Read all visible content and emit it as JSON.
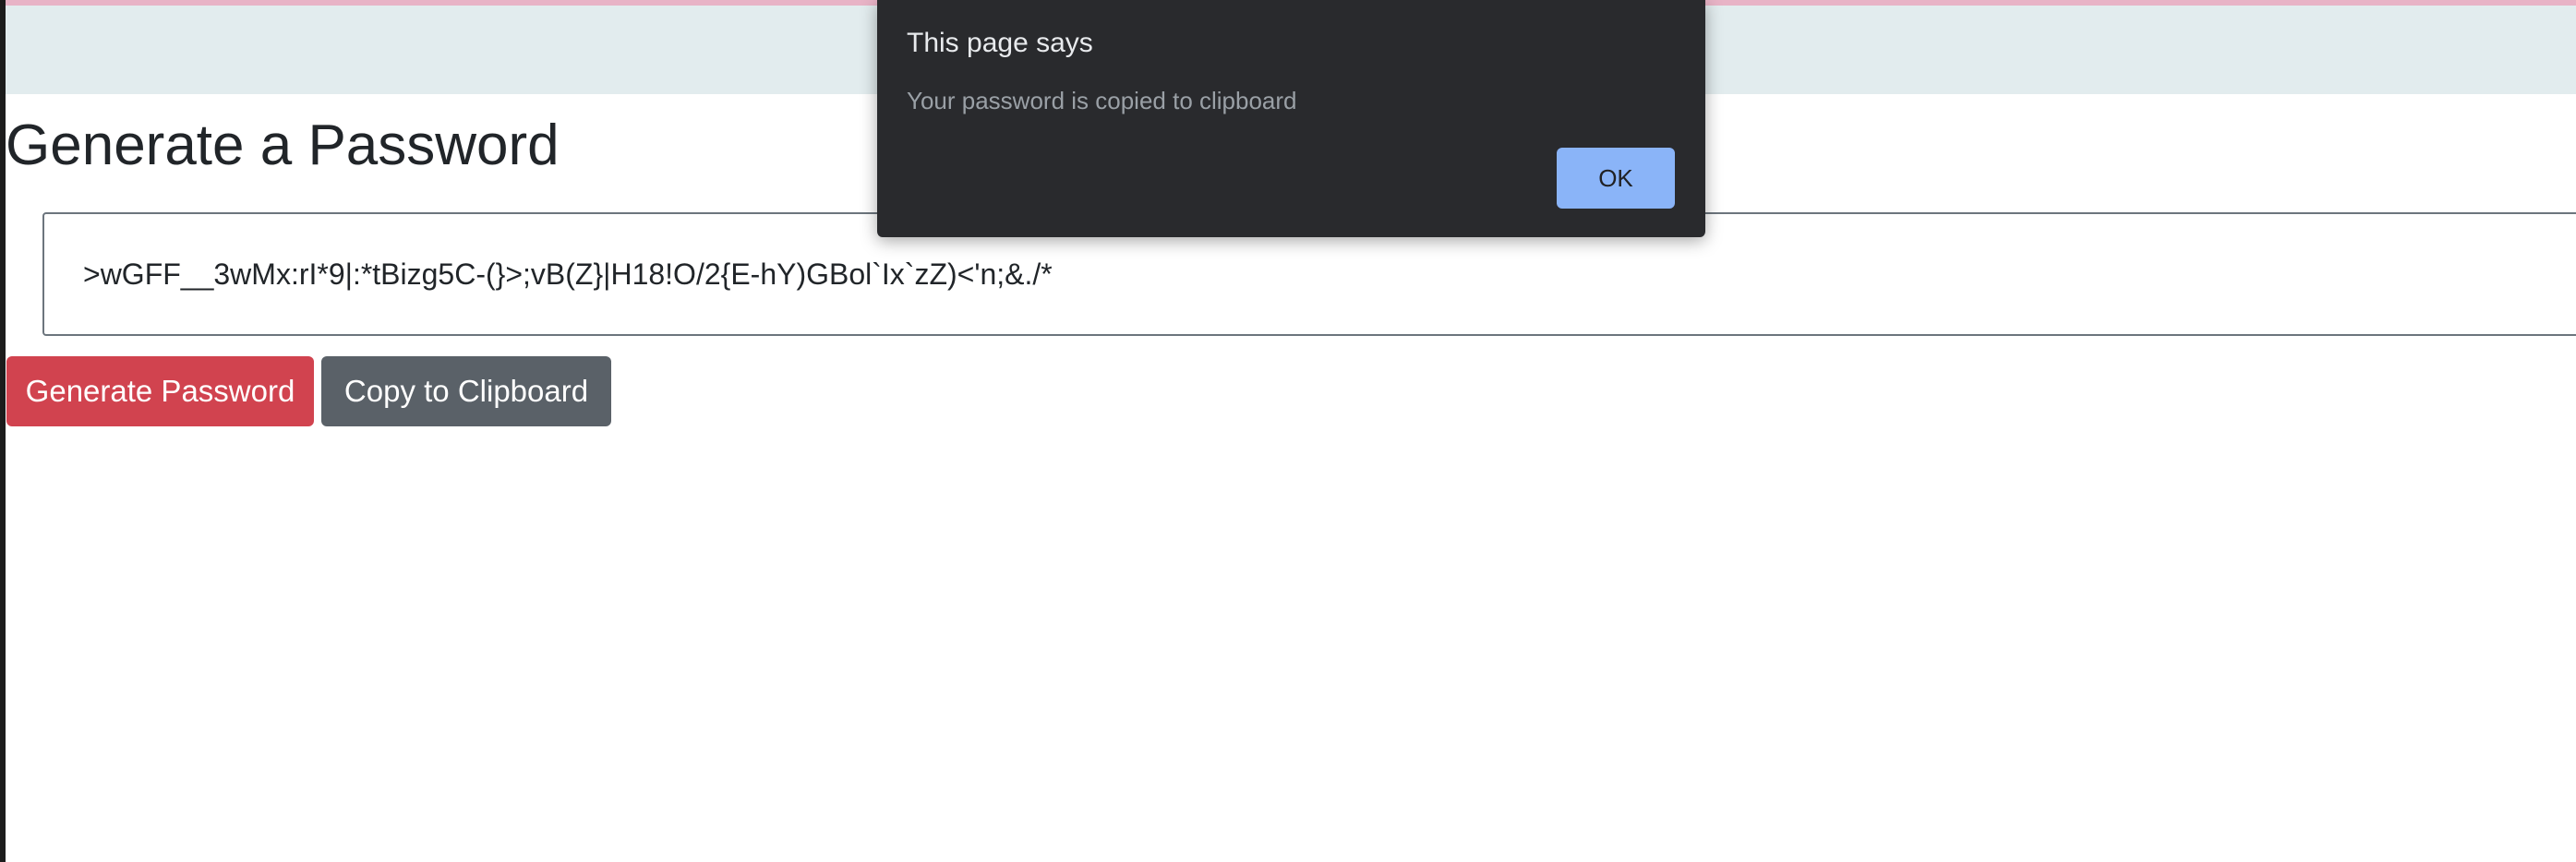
{
  "page": {
    "title": "Generate a Password",
    "password_value": ">wGFF__3wMx:rI*9|:*tBizg5C-(}>;vB(Z}|H18!O/2{E-hY)GBol`Ix`zZ)<'n;&./*"
  },
  "buttons": {
    "generate_label": "Generate Password",
    "copy_label": "Copy to Clipboard"
  },
  "dialog": {
    "title": "This page says",
    "message": "Your password is copied to clipboard",
    "ok_label": "OK"
  },
  "colors": {
    "header_band": "#e2ecee",
    "top_strip": "#e8b3c6",
    "generate_button": "#d1434f",
    "copy_button": "#5a6168",
    "dialog_background": "#292a2d",
    "dialog_ok_button": "#8ab4f8"
  }
}
